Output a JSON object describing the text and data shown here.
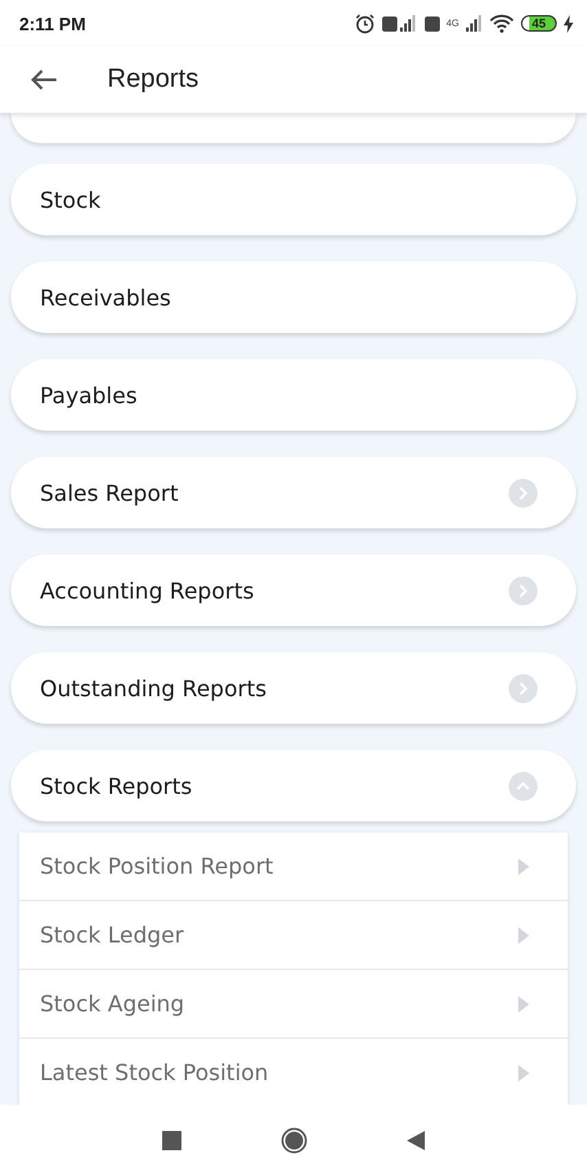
{
  "status_bar": {
    "time": "2:11 PM",
    "network_type": "4G",
    "battery": "45"
  },
  "app_bar": {
    "title": "Reports"
  },
  "reports": [
    {
      "label": "Stock",
      "kind": "link"
    },
    {
      "label": "Receivables",
      "kind": "link"
    },
    {
      "label": "Payables",
      "kind": "link"
    },
    {
      "label": "Sales Report",
      "kind": "group",
      "expanded": false
    },
    {
      "label": "Accounting Reports",
      "kind": "group",
      "expanded": false
    },
    {
      "label": "Outstanding Reports",
      "kind": "group",
      "expanded": false
    },
    {
      "label": "Stock Reports",
      "kind": "group",
      "expanded": true,
      "children": [
        {
          "label": "Stock Position Report"
        },
        {
          "label": "Stock Ledger"
        },
        {
          "label": "Stock Ageing"
        },
        {
          "label": "Latest Stock Position"
        }
      ]
    }
  ]
}
